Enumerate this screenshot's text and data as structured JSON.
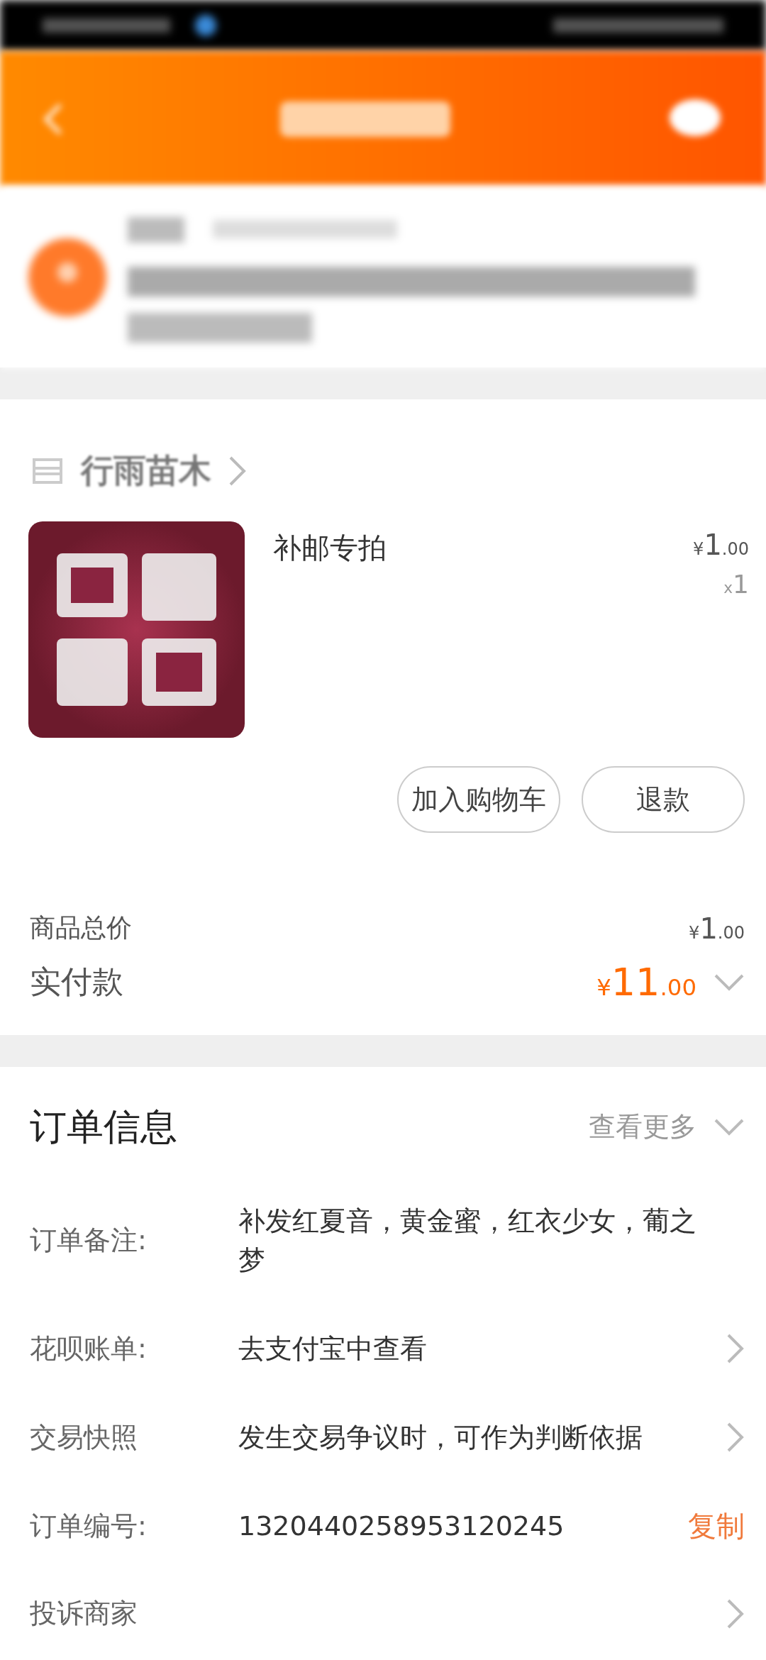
{
  "store": {
    "name": "行雨苗木"
  },
  "product": {
    "kind": "picture",
    "name": "补邮专拍",
    "currency": "¥",
    "price_int": "1",
    "price_dec": ".00",
    "qty_prefix": "x",
    "qty": "1"
  },
  "actions": [
    {
      "label": "加入购物车"
    },
    {
      "label": "退款"
    }
  ],
  "totals": [
    {
      "kind": "plain",
      "label": "商品总价",
      "currency": "¥",
      "int": "1",
      "dec": ".00",
      "expandable": false
    },
    {
      "kind": "highlight",
      "label": "实付款",
      "currency": "¥",
      "int": "11",
      "dec": ".00",
      "expandable": true
    }
  ],
  "order_info": {
    "title": "订单信息",
    "more": "查看更多",
    "rows": [
      {
        "kind": "text",
        "label": "订单备注:",
        "value": "补发红夏音，黄金蜜，红衣少女，葡之梦"
      },
      {
        "kind": "link",
        "label": "花呗账单:",
        "value": "去支付宝中查看"
      },
      {
        "kind": "link",
        "label": "交易快照",
        "value": "发生交易争议时，可作为判断依据"
      },
      {
        "kind": "copy",
        "label": "订单编号:",
        "value": "1320440258953120245",
        "action": "复制"
      },
      {
        "kind": "link",
        "label": "投诉商家",
        "value": ""
      }
    ]
  }
}
